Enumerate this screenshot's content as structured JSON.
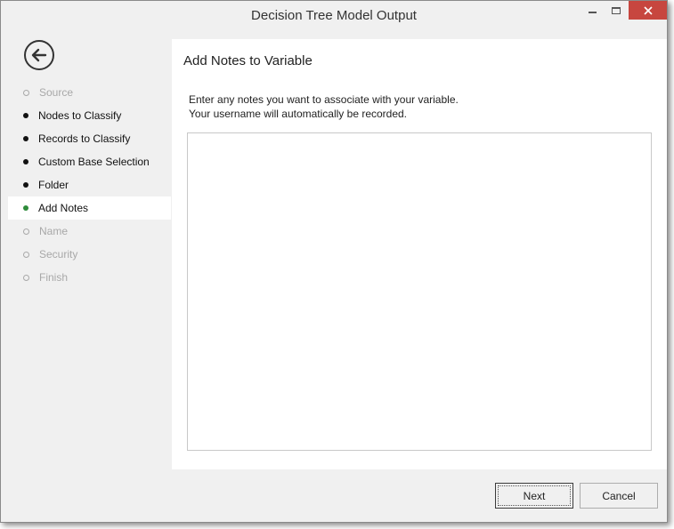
{
  "window": {
    "title": "Decision Tree Model Output"
  },
  "sidebar": {
    "steps": [
      {
        "label": "Source",
        "state": "disabled"
      },
      {
        "label": "Nodes to Classify",
        "state": "done"
      },
      {
        "label": "Records to Classify",
        "state": "done"
      },
      {
        "label": "Custom Base Selection",
        "state": "done"
      },
      {
        "label": "Folder",
        "state": "done"
      },
      {
        "label": "Add Notes",
        "state": "active"
      },
      {
        "label": "Name",
        "state": "disabled"
      },
      {
        "label": "Security",
        "state": "disabled"
      },
      {
        "label": "Finish",
        "state": "disabled"
      }
    ]
  },
  "content": {
    "title": "Add Notes to Variable",
    "instruction_line1": "Enter any notes you want to associate with your variable.",
    "instruction_line2": "Your username will automatically be recorded.",
    "notes_value": ""
  },
  "footer": {
    "next_label": "Next",
    "cancel_label": "Cancel"
  },
  "colors": {
    "active_dot": "#2e8b3a",
    "close_button": "#c7463f"
  },
  "icons": {
    "back": "back-arrow-circle-icon",
    "minimize": "minimize-icon",
    "maximize": "maximize-icon",
    "close": "close-icon"
  }
}
